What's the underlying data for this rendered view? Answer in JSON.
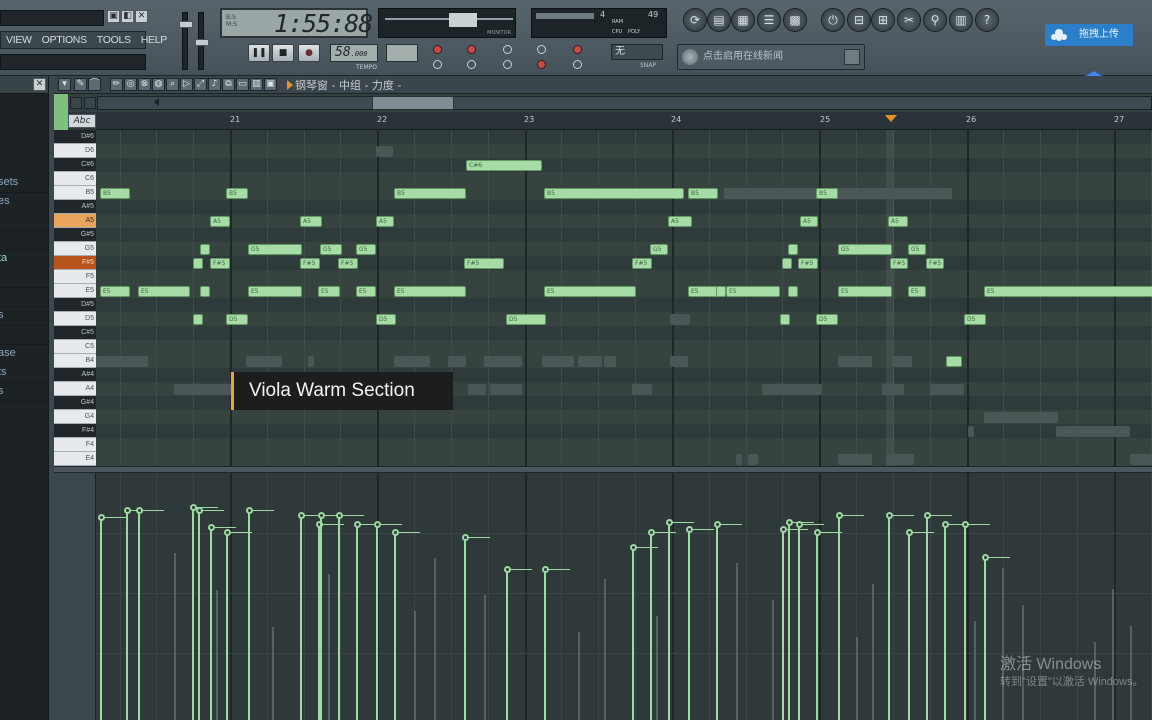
{
  "menu": [
    "VIEW",
    "OPTIONS",
    "TOOLS",
    "HELP"
  ],
  "window_buttons": [
    "▣",
    "◧",
    "✕"
  ],
  "transport": {
    "time": "1:55:88",
    "time_label_top": "B:S",
    "time_label_bottom": "M:S",
    "tempo": "58",
    "tempo_sup": ".000",
    "tempo_label": "TEMPO",
    "monitor_label": "MONITOR",
    "snap_value": "无",
    "snap_label": "SNAP",
    "pause_glyph": "❚❚",
    "stop_glyph": "■",
    "record_glyph": "●"
  },
  "cpu": {
    "voices": "4",
    "value": "49",
    "ram": "RAM",
    "cpu": "CPU",
    "poly": "POLY"
  },
  "round_buttons": [
    "⟳",
    "▤",
    "▦",
    "☰",
    "▩",
    "⏻",
    "⊟",
    "⊞",
    "✂",
    "⚲",
    "▥",
    "?"
  ],
  "news_text": "点击启用在线新闻",
  "upload": {
    "label": "拖拽上传"
  },
  "browser": {
    "close": "✕",
    "items": [
      {
        "label": "sets",
        "green": false
      },
      {
        "label": "es",
        "green": false
      },
      {
        "label": "",
        "green": false
      },
      {
        "label": "",
        "green": false
      },
      {
        "label": "ta",
        "green": true
      },
      {
        "label": "",
        "green": false
      },
      {
        "label": "",
        "green": false
      },
      {
        "label": "s",
        "green": false
      },
      {
        "label": "",
        "green": false
      },
      {
        "label": "ase",
        "green": false
      },
      {
        "label": "ts",
        "green": false
      },
      {
        "label": "s",
        "green": false
      }
    ]
  },
  "piano_roll": {
    "tool_icons": [
      "▾",
      "✎",
      "⌒",
      "✏",
      "◎",
      "⊗",
      "◍",
      "⌕",
      "▷",
      "⤢",
      "♪",
      "⧉",
      "▭",
      "▥",
      "▣"
    ],
    "breadcrumb": "钢琴窗 - 中组 - 力度 -",
    "abc_label": "Abc",
    "bars": [
      "21",
      "22",
      "23",
      "24",
      "25",
      "26",
      "27"
    ]
  },
  "keyboard": [
    {
      "label": "D#6",
      "black": true,
      "hl": ""
    },
    {
      "label": "D6",
      "black": false,
      "hl": ""
    },
    {
      "label": "C#6",
      "black": true,
      "hl": ""
    },
    {
      "label": "C6",
      "black": false,
      "hl": ""
    },
    {
      "label": "B5",
      "black": false,
      "hl": ""
    },
    {
      "label": "A#5",
      "black": true,
      "hl": ""
    },
    {
      "label": "A5",
      "black": false,
      "hl": "light"
    },
    {
      "label": "G#5",
      "black": true,
      "hl": ""
    },
    {
      "label": "G5",
      "black": false,
      "hl": ""
    },
    {
      "label": "F#5",
      "black": true,
      "hl": "dark"
    },
    {
      "label": "F5",
      "black": false,
      "hl": ""
    },
    {
      "label": "E5",
      "black": false,
      "hl": ""
    },
    {
      "label": "D#5",
      "black": true,
      "hl": ""
    },
    {
      "label": "D5",
      "black": false,
      "hl": ""
    },
    {
      "label": "C#5",
      "black": true,
      "hl": ""
    },
    {
      "label": "C5",
      "black": false,
      "hl": ""
    },
    {
      "label": "B4",
      "black": false,
      "hl": ""
    },
    {
      "label": "A#4",
      "black": true,
      "hl": ""
    },
    {
      "label": "A4",
      "black": false,
      "hl": ""
    },
    {
      "label": "G#4",
      "black": true,
      "hl": ""
    },
    {
      "label": "G4",
      "black": false,
      "hl": ""
    },
    {
      "label": "F#4",
      "black": true,
      "hl": ""
    },
    {
      "label": "F4",
      "black": false,
      "hl": ""
    },
    {
      "label": "E4",
      "black": false,
      "hl": ""
    }
  ],
  "tooltip": "Viola Warm Section",
  "watermark": {
    "title": "激活 Windows",
    "subtitle": "转到\"设置\"以激活 Windows。"
  }
}
